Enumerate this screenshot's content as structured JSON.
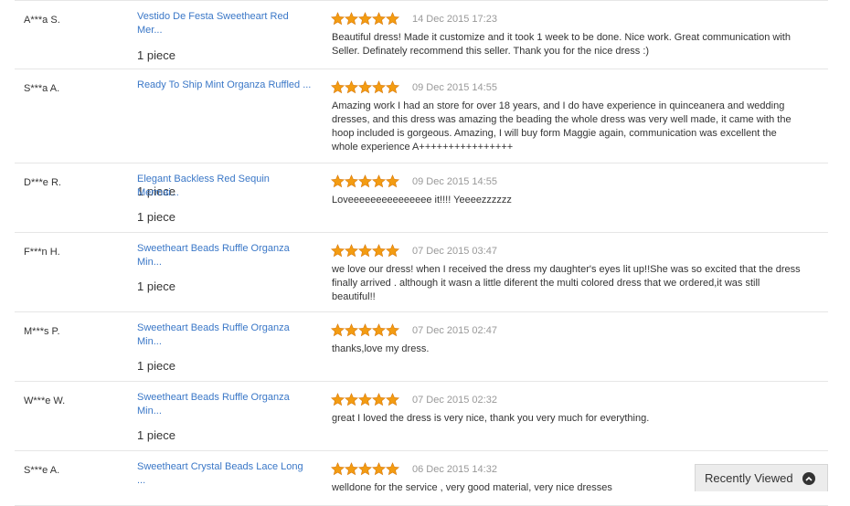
{
  "reviews": [
    {
      "buyer": "A***a S.",
      "product": [
        "Vestido De Festa Sweetheart Red",
        "Mer..."
      ],
      "quantity": "1 piece",
      "rating": 5,
      "date": "14 Dec 2015 17:23",
      "feedback": [
        "Beautiful dress! Made it customize and it took 1 week to be done. Nice work. Great communication with",
        "Seller. Definately recommend this seller. Thank you for the nice dress :)"
      ]
    },
    {
      "buyer": "S***a A.",
      "product": [
        "Ready To Ship Mint Organza Ruffled ..."
      ],
      "quantity": "1 piece",
      "rating": 5,
      "date": "09 Dec 2015 14:55",
      "feedback": [
        "Amazing work I had an store for over 18 years, and I do have experience in quinceanera and wedding",
        "dresses, and this dress was amazing the beading the whole dress was very well made, it came with the",
        "hoop included is gorgeous. Amazing, I will buy form Maggie again, communication was excellent the",
        "whole experience A++++++++++++++++"
      ]
    },
    {
      "buyer": "D***e R.",
      "product": [
        "Elegant Backless Red Sequin",
        "Mermai..."
      ],
      "quantity": "1 piece",
      "rating": 5,
      "date": "09 Dec 2015 14:55",
      "feedback": [
        "Loveeeeeeeeeeeeeee it!!!! Yeeeezzzzzz"
      ]
    },
    {
      "buyer": "F***n H.",
      "product": [
        "Sweetheart Beads Ruffle Organza",
        "Min..."
      ],
      "quantity": "1 piece",
      "rating": 5,
      "date": "07 Dec 2015 03:47",
      "feedback": [
        "we love our dress! when I received the dress my daughter's eyes lit up!!She was so excited that the dress",
        "finally arrived . although it wasn a little diferent the multi colored dress that we ordered,it was still",
        "beautiful!!"
      ]
    },
    {
      "buyer": "M***s P.",
      "product": [
        "Sweetheart Beads Ruffle Organza",
        "Min..."
      ],
      "quantity": "1 piece",
      "rating": 5,
      "date": "07 Dec 2015 02:47",
      "feedback": [
        "thanks,love my dress."
      ]
    },
    {
      "buyer": "W***e W.",
      "product": [
        "Sweetheart Beads Ruffle Organza",
        "Min..."
      ],
      "quantity": "1 piece",
      "rating": 5,
      "date": "07 Dec 2015 02:32",
      "feedback": [
        "great I loved the dress is very nice, thank you very much for everything."
      ]
    },
    {
      "buyer": "S***e A.",
      "product": [
        "Sweetheart Crystal Beads Lace Long",
        "..."
      ],
      "quantity": "",
      "rating": 5,
      "date": "06 Dec 2015 14:32",
      "feedback": [
        "welldone for the service , very good material, very nice dresses"
      ]
    }
  ],
  "recently_viewed": {
    "label": "Recently Viewed",
    "icon": "chevron-up-circle-icon"
  },
  "colors": {
    "link": "#3a77c7",
    "star": "#f39c12",
    "divider": "#e6e6e6",
    "date": "#999999"
  }
}
